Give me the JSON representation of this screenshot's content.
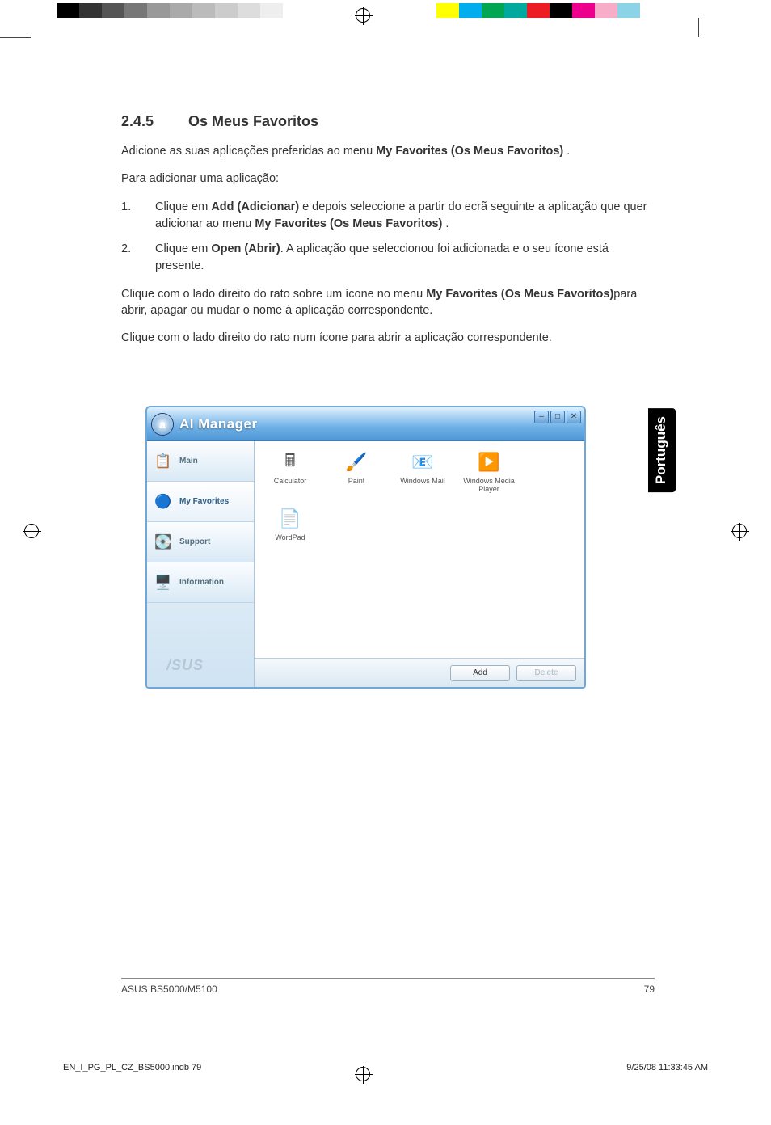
{
  "section": {
    "number": "2.4.5",
    "title": "Os Meus Favoritos"
  },
  "para1_a": "Adicione as suas aplicações preferidas ao menu ",
  "para1_b": "My Favorites (Os Meus Favoritos)",
  "para1_c": " .",
  "para2": "Para adicionar uma aplicação:",
  "step1_a": "Clique em ",
  "step1_b": "Add (Adicionar)",
  "step1_c": " e depois seleccione a partir do ecrã seguinte a aplicação que quer adicionar ao menu ",
  "step1_d": "My Favorites (Os Meus Favoritos)",
  "step1_e": " .",
  "step2_a": "Clique em ",
  "step2_b": "Open (Abrir)",
  "step2_c": ". A aplicação que seleccionou foi adicionada e o seu ícone está presente.",
  "para3_a": "Clique com o lado direito do rato sobre um ícone no menu ",
  "para3_b": "My Favorites (Os Meus Favoritos)",
  "para3_c": "para abrir, apagar ou mudar o nome à aplicação correspondente.",
  "para4": "Clique com o lado direito do rato num ícone para abrir a aplicação correspondente.",
  "lang_tab": "Português",
  "window": {
    "title": "AI Manager",
    "icon_letter": "a",
    "sidebar": [
      {
        "label": "Main",
        "glyph": "📋"
      },
      {
        "label": "My Favorites",
        "glyph": "🔵"
      },
      {
        "label": "Support",
        "glyph": "💽"
      },
      {
        "label": "Information",
        "glyph": "🖥️"
      }
    ],
    "brand": "/SUS",
    "apps": [
      {
        "label": "Calculator",
        "glyph": "🖩"
      },
      {
        "label": "Paint",
        "glyph": "🖌️"
      },
      {
        "label": "Windows Mail",
        "glyph": "📧"
      },
      {
        "label": "Windows Media Player",
        "glyph": "▶️"
      },
      {
        "label": "WordPad",
        "glyph": "📄"
      }
    ],
    "buttons": {
      "add": "Add",
      "delete": "Delete"
    }
  },
  "footer": {
    "left": "ASUS BS5000/M5100",
    "right": "79"
  },
  "print_footer": {
    "left": "EN_I_PG_PL_CZ_BS5000.indb   79",
    "right": "9/25/08   11:33:45 AM"
  },
  "grays": [
    "#000",
    "#333",
    "#555",
    "#777",
    "#999",
    "#aaa",
    "#bbb",
    "#ccc",
    "#ddd",
    "#eee",
    "#fff"
  ],
  "colors": [
    "#ffff00",
    "#00aeef",
    "#00a651",
    "#00a99d",
    "#ed1c24",
    "#000",
    "#ec008c",
    "#f7adc8",
    "#8cd3e8",
    "#fff"
  ]
}
